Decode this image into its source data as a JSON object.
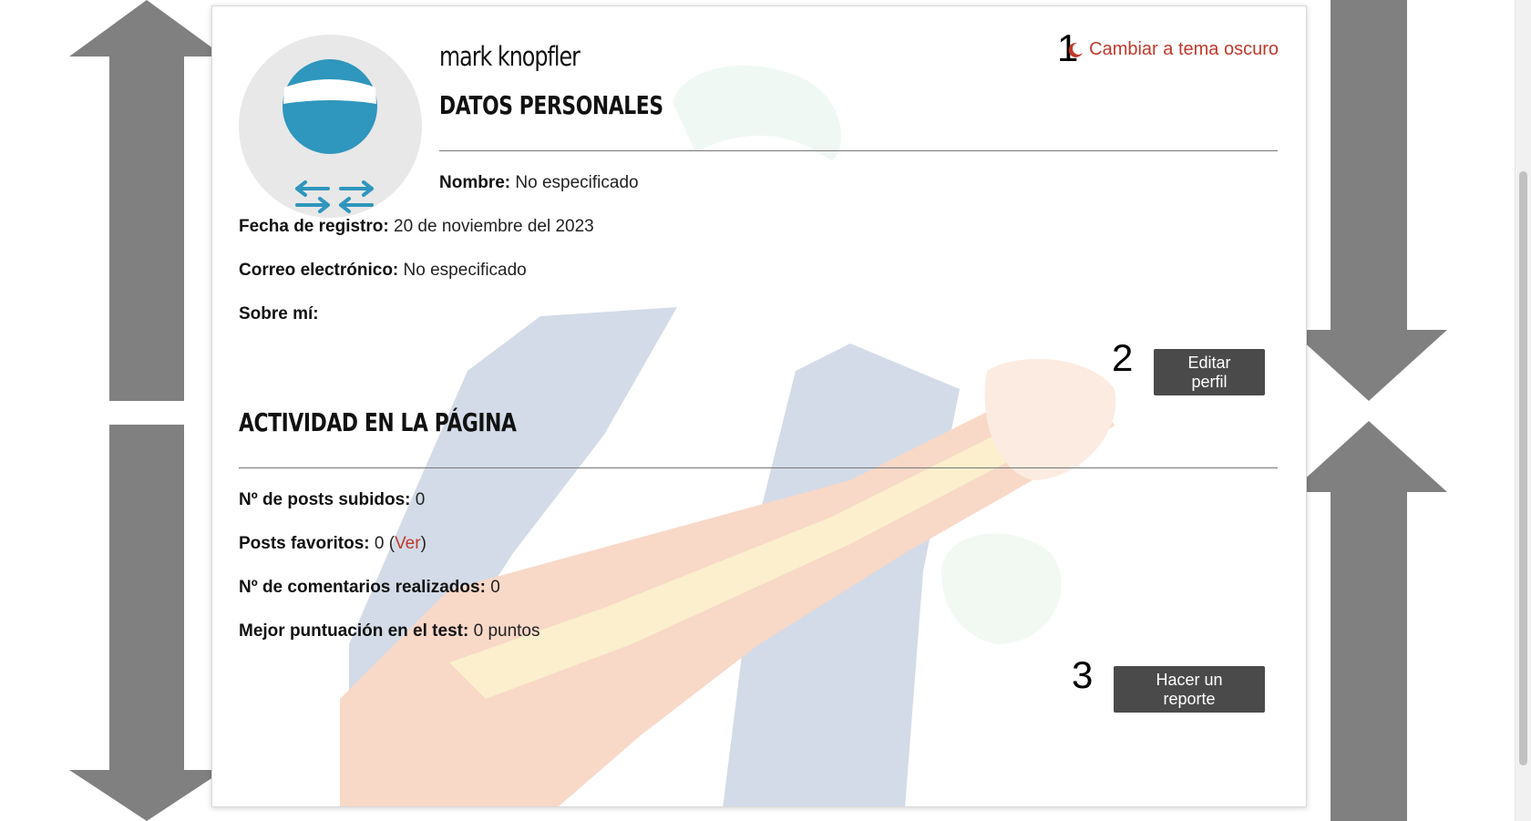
{
  "profile": {
    "username": "mark knopfler",
    "theme_toggle_label": "Cambiar a tema oscuro",
    "theme_toggle_icon": "moon-icon"
  },
  "personal_section": {
    "title": "DATOS PERSONALES",
    "fields": [
      {
        "label": "Nombre:",
        "value": "No especificado"
      },
      {
        "label": "Fecha de registro:",
        "value": "20 de noviembre del 2023"
      },
      {
        "label": "Correo electrónico:",
        "value": "No especificado"
      },
      {
        "label": "Sobre mí:",
        "value": ""
      }
    ],
    "edit_button": "Editar perfil"
  },
  "activity_section": {
    "title": "ACTIVIDAD EN LA PÁGINA",
    "posts_uploaded": {
      "label": "Nº de posts subidos:",
      "value": "0"
    },
    "favorite_posts": {
      "label": "Posts favoritos:",
      "value": "0",
      "open": " (",
      "link": "Ver",
      "close": ")"
    },
    "comments_made": {
      "label": "Nº de comentarios realizados:",
      "value": "0"
    },
    "best_score": {
      "label": "Mejor puntuación en el test:",
      "value": "0 puntos"
    },
    "report_button": "Hacer un reporte"
  },
  "annotations": {
    "one": "1",
    "two": "2",
    "three": "3"
  },
  "colors": {
    "accent": "#c0392b",
    "button_bg": "#4a4a4a",
    "avatar_blue": "#2f96bd",
    "arrow_gray": "#808080"
  }
}
